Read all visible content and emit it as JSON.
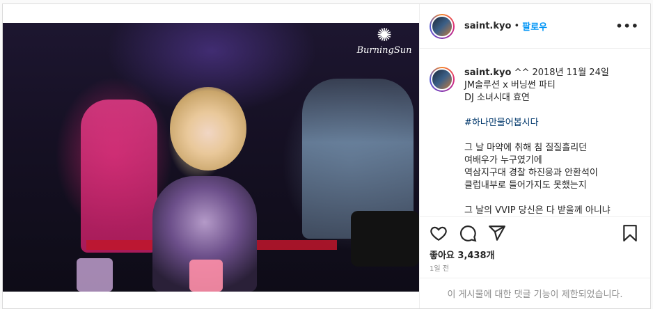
{
  "post": {
    "username": "saint.kyo",
    "separator": "•",
    "follow_label": "팔로우",
    "more_label": "•••",
    "photo_logo": "BurningSun",
    "caption": {
      "username": "saint.kyo",
      "first_line": " ^^ 2018년 11월 24일",
      "lines_1": [
        "JM솔루션 x 버닝썬 파티",
        "DJ 소녀시대 효연"
      ],
      "hashtag": "#하나만물어봅시다",
      "lines_2": [
        "그 날 마약에 취해 침 질질흘리던",
        "여배우가 누구였기에",
        "역삼지구대 경찰 하진웅과 안환석이",
        "클럽내부로 들어가지도 못했는지"
      ],
      "overflow_line": "그 날의 VVIP 당신은 다 받을께 아니냐"
    },
    "likes_label": "좋아요 3,438개",
    "time_label": "1일 전",
    "comments_restricted": "이 게시물에 대한 댓글 기능이 제한되었습니다.",
    "icons": {
      "like": "heart-icon",
      "comment": "comment-icon",
      "share": "share-icon",
      "save": "bookmark-icon"
    }
  }
}
